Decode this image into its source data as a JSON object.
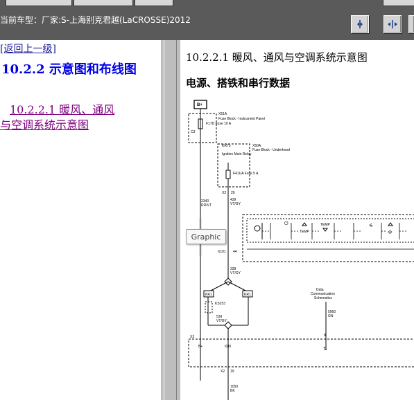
{
  "header": {
    "vehicle_info": "当前车型：厂家:S-上海别克君越(LaCROSSE)2012"
  },
  "toolbar": {
    "icons": [
      "collapse-panel-icon",
      "split-view-icon",
      "exit-icon"
    ]
  },
  "nav": {
    "back_link": "[返回上一级]",
    "section_heading": "10.2.2 示意图和布线图",
    "subsection_line1": "10.2.2.1 暖风、通风",
    "subsection_line2": "与空调系统示意图"
  },
  "content": {
    "title": "10.2.2.1 暖风、通风与空调系统示意图",
    "subtitle": "电源、搭铁和串行数据"
  },
  "tooltip": {
    "text": "Graphic"
  },
  "diagram_labels": {
    "b_plus": "B+",
    "x51a": "X51A",
    "fuse_block_ip": "Fuse Block - Instrument Panel",
    "f17d_fuse": "F17D Fuse 10 A",
    "x50a": "X50A",
    "fuse_block_uh": "Fuse Block - Underhood",
    "kr75": "KR75",
    "ignition_relay": "Ignition Main Relay",
    "f41ua_fuse": "F41UA Fuse 5 A",
    "pin_c3": "C3",
    "pin_x2": "X2",
    "pin_29": "29",
    "wire_2340": "2340",
    "wire_rdvt": "RD/VT",
    "wire_439": "439",
    "wire_vtgy": "VT/GY",
    "x101": "X101",
    "pin_44": "44",
    "wire_339": "339",
    "wire_vtgy_2": "VT/GY",
    "kr1a": "KR1",
    "kr1b": "KR1",
    "ks253": "KS253",
    "wire_539": "539",
    "wire_vtgy_3": "VT/GY",
    "data_comm_line1": "Data",
    "data_comm_line2": "Communication",
    "data_comm_line3": "Schematics",
    "wire_5060": "5060",
    "wire_gn": "GN",
    "pin_x3": "X3",
    "pin_b_plus": "B+",
    "ign": "IGN",
    "pin_8": "8",
    "pin_x2b": "X2",
    "pin_19": "19",
    "wire_1050": "1050",
    "wire_bk": "BK",
    "temp1": "TEMP",
    "temp2": "TEMP"
  }
}
